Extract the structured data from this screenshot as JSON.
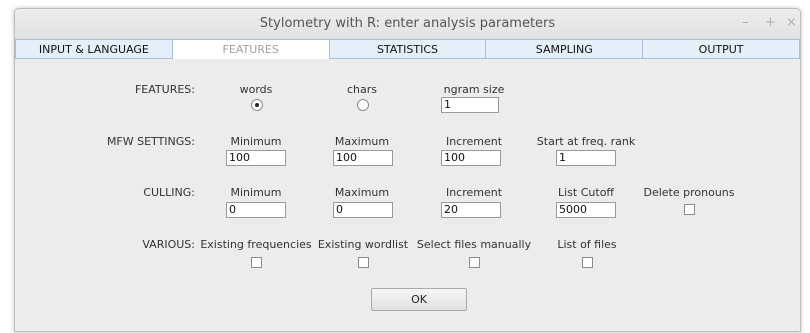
{
  "window": {
    "title": "Stylometry with R: enter analysis parameters",
    "buttons": {
      "minimize": "–",
      "maximize": "+",
      "close": "×"
    }
  },
  "tabs": [
    {
      "label": "INPUT & LANGUAGE",
      "active": false
    },
    {
      "label": "FEATURES",
      "active": true
    },
    {
      "label": "STATISTICS",
      "active": false
    },
    {
      "label": "SAMPLING",
      "active": false
    },
    {
      "label": "OUTPUT",
      "active": false
    }
  ],
  "features": {
    "label": "FEATURES:",
    "words_label": "words",
    "chars_label": "chars",
    "selected": "words",
    "ngram_label": "ngram size",
    "ngram_value": "1"
  },
  "mfw": {
    "label": "MFW SETTINGS:",
    "minimum_label": "Minimum",
    "minimum_value": "100",
    "maximum_label": "Maximum",
    "maximum_value": "100",
    "increment_label": "Increment",
    "increment_value": "100",
    "start_label": "Start at freq. rank",
    "start_value": "1"
  },
  "culling": {
    "label": "CULLING:",
    "minimum_label": "Minimum",
    "minimum_value": "0",
    "maximum_label": "Maximum",
    "maximum_value": "0",
    "increment_label": "Increment",
    "increment_value": "20",
    "cutoff_label": "List Cutoff",
    "cutoff_value": "5000",
    "pronouns_label": "Delete pronouns",
    "pronouns_checked": false
  },
  "various": {
    "label": "VARIOUS:",
    "existing_freq_label": "Existing frequencies",
    "existing_wordlist_label": "Existing wordlist",
    "select_files_label": "Select files manually",
    "list_files_label": "List of files"
  },
  "ok_label": "OK"
}
